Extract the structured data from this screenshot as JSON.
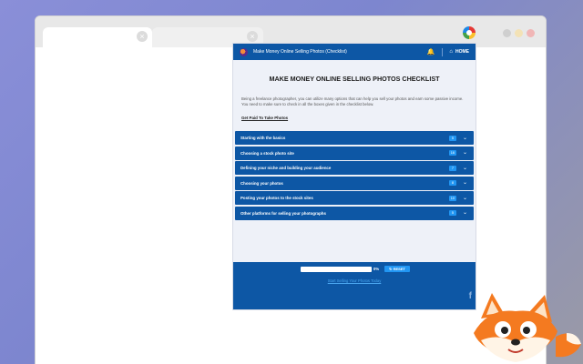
{
  "popup": {
    "header": {
      "title": "Make Money Online Selling Photos (Checklist)",
      "home_label": "HOME"
    },
    "main_title": "MAKE MONEY ONLINE SELLING PHOTOS CHECKLIST",
    "description": "Being a freelance photographer, you can utilize many options that can help you sell your photos and earn some passive income. You need to make sure to check in all the boxes given in the checklist below.",
    "description_link": "Get Paid To Take Photos",
    "sections": [
      {
        "label": "Starting with the basics",
        "count": "5"
      },
      {
        "label": "Choosing a stock photo site",
        "count": "16"
      },
      {
        "label": "Defining your niche and building your audience",
        "count": "7"
      },
      {
        "label": "Choosing your photos",
        "count": "8"
      },
      {
        "label": "Posting your photos to the stock sites",
        "count": "10"
      },
      {
        "label": "Other platforms for selling your photographs",
        "count": "5"
      }
    ],
    "footer": {
      "progress_percent": "0%",
      "progress_value": 0,
      "reset_label": "RESET",
      "start_link": "Start Selling Your Photos Today"
    }
  },
  "colors": {
    "brand_blue": "#0d57a5",
    "badge_blue": "#2196f3",
    "link_blue": "#4aa6f0"
  },
  "icons": {
    "bell": "bell-icon",
    "home": "home-icon",
    "chevron": "chevron-down-icon",
    "reset": "refresh-icon",
    "facebook": "facebook-icon"
  }
}
